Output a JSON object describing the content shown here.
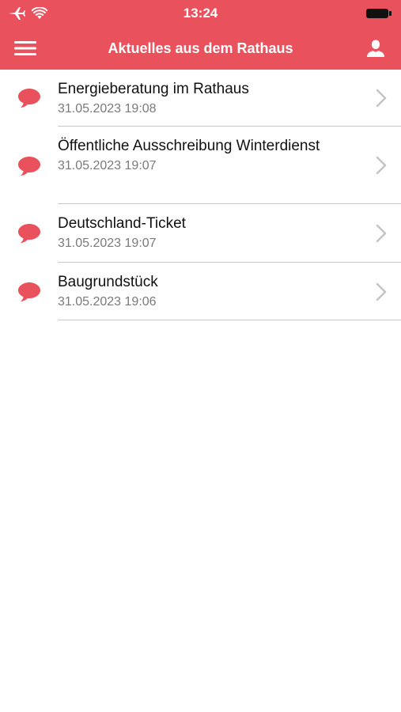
{
  "status_bar": {
    "time": "13:24",
    "airplane_icon": "airplane-icon",
    "wifi_icon": "wifi-icon",
    "battery_icon": "battery-icon"
  },
  "header": {
    "title": "Aktuelles aus dem Rathaus",
    "menu_icon": "hamburger-menu-icon",
    "profile_icon": "user-profile-icon",
    "background_color": "#e9515c",
    "text_color": "#ffffff"
  },
  "news": {
    "items": [
      {
        "title": "Energieberatung im Rathaus",
        "date": "31.05.2023 19:08",
        "icon": "speech-bubble-icon"
      },
      {
        "title": "Öffentliche Ausschreibung Winterdienst",
        "date": "31.05.2023 19:07",
        "icon": "speech-bubble-icon"
      },
      {
        "title": "Deutschland-Ticket",
        "date": "31.05.2023 19:07",
        "icon": "speech-bubble-icon"
      },
      {
        "title": "Baugrundstück",
        "date": "31.05.2023 19:06",
        "icon": "speech-bubble-icon"
      }
    ],
    "accent_color": "#e9515c",
    "chevron_icon": "chevron-right-icon"
  }
}
